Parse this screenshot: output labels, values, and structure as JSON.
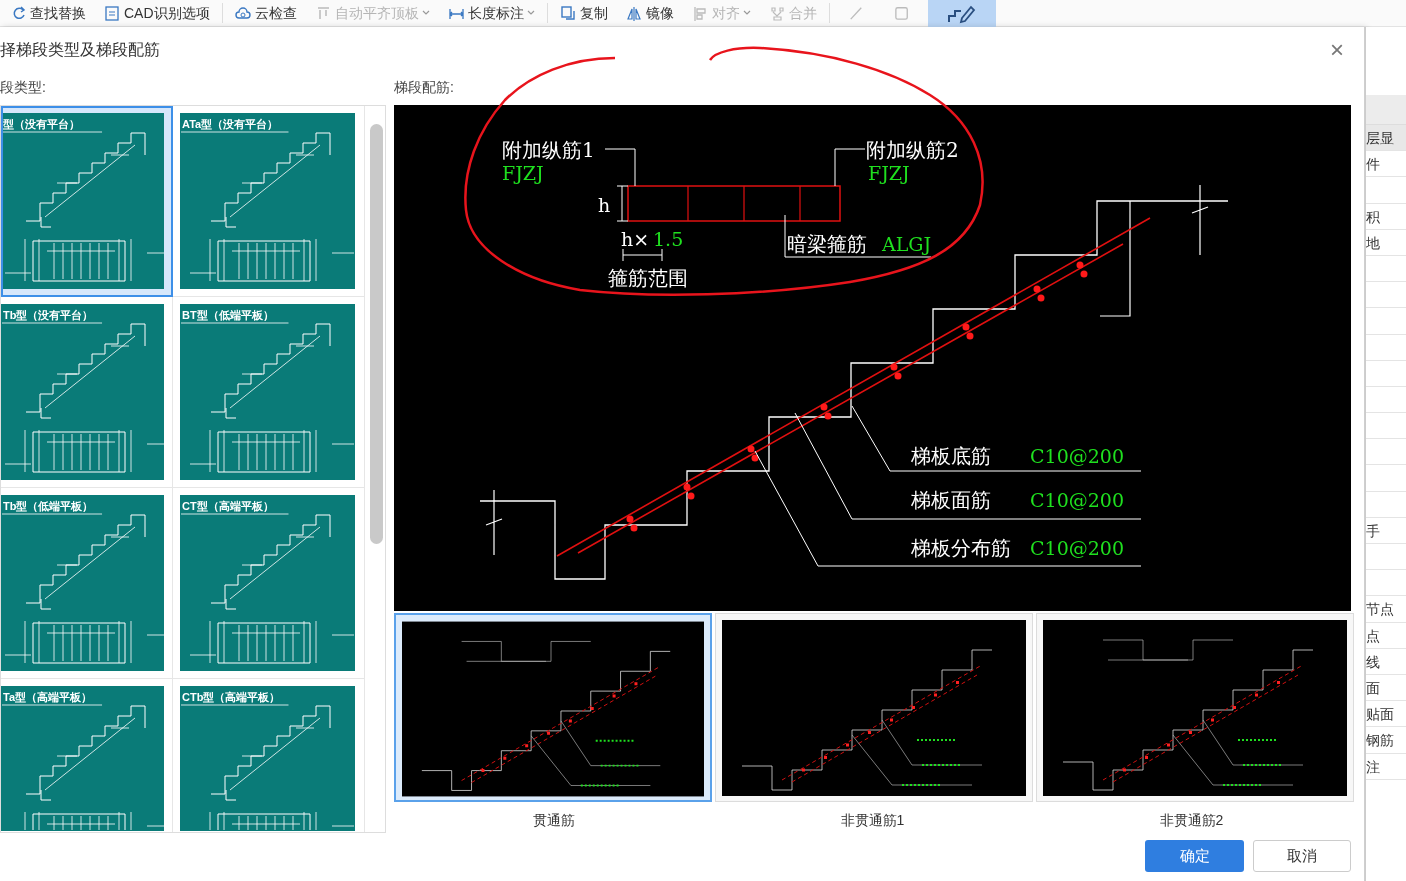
{
  "toolbar": {
    "items": [
      {
        "kind": "find-replace",
        "label": "查找替换",
        "disabled": false,
        "has_menu": false
      },
      {
        "kind": "cad",
        "label": "CAD识别选项",
        "disabled": false,
        "has_menu": false
      },
      {
        "kind": "cloud",
        "label": "云检查",
        "disabled": false,
        "has_menu": false
      },
      {
        "kind": "align-top",
        "label": "自动平齐顶板",
        "disabled": true,
        "has_menu": true
      },
      {
        "kind": "dimension",
        "label": "长度标注",
        "disabled": false,
        "has_menu": true
      },
      {
        "kind": "copy",
        "label": "复制",
        "disabled": false,
        "has_menu": false
      },
      {
        "kind": "mirror",
        "label": "镜像",
        "disabled": false,
        "has_menu": false
      },
      {
        "kind": "align",
        "label": "对齐",
        "disabled": true,
        "has_menu": true
      },
      {
        "kind": "merge",
        "label": "合并",
        "disabled": true,
        "has_menu": false
      }
    ],
    "icon_buttons": [
      {
        "kind": "line",
        "selected": false
      },
      {
        "kind": "square",
        "selected": false
      },
      {
        "kind": "stair-pen",
        "selected": true
      }
    ]
  },
  "dialog": {
    "title": "择梯段类型及梯段配筋",
    "close": "×",
    "types_label": "段类型:",
    "rebar_label": "梯段配筋:"
  },
  "stair_types": [
    {
      "title": "型（没有平台）",
      "selected": true
    },
    {
      "title": "ATa型（没有平台）",
      "selected": false
    },
    {
      "title": "Tb型（没有平台）",
      "selected": false
    },
    {
      "title": "BT型（低端平板）",
      "selected": false
    },
    {
      "title": "Tb型（低端平板）",
      "selected": false
    },
    {
      "title": "CT型（高端平板）",
      "selected": false
    },
    {
      "title": "Ta型（高端平板）",
      "selected": false
    },
    {
      "title": "CTb型（高端平板）",
      "selected": false
    }
  ],
  "main_diagram": {
    "left_label": "附加纵筋1",
    "left_code": "FJZJ",
    "right_label": "附加纵筋2",
    "right_code": "FJZJ",
    "height_mark": "h",
    "range_prefix": "h×",
    "range_factor": "1.5",
    "range_label": "箍筋范围",
    "beam_label": "暗梁箍筋",
    "beam_code": "ALGJ",
    "rebars": [
      {
        "name": "梯板底筋",
        "spec": "C10@200"
      },
      {
        "name": "梯板面筋",
        "spec": "C10@200"
      },
      {
        "name": "梯板分布筋",
        "spec": "C10@200"
      }
    ]
  },
  "rebar_layouts": [
    {
      "caption": "贯通筋",
      "selected": true
    },
    {
      "caption": "非贯通筋1",
      "selected": false
    },
    {
      "caption": "非贯通筋2",
      "selected": false
    }
  ],
  "buttons": {
    "ok": "确定",
    "cancel": "取消"
  },
  "side_panel": {
    "groups": [
      [
        "层显",
        "件"
      ],
      [
        "积",
        "地"
      ],
      [
        "手"
      ],
      [
        "节点",
        "点",
        "线",
        "面",
        "贴面",
        "钢筋",
        "注"
      ]
    ]
  }
}
